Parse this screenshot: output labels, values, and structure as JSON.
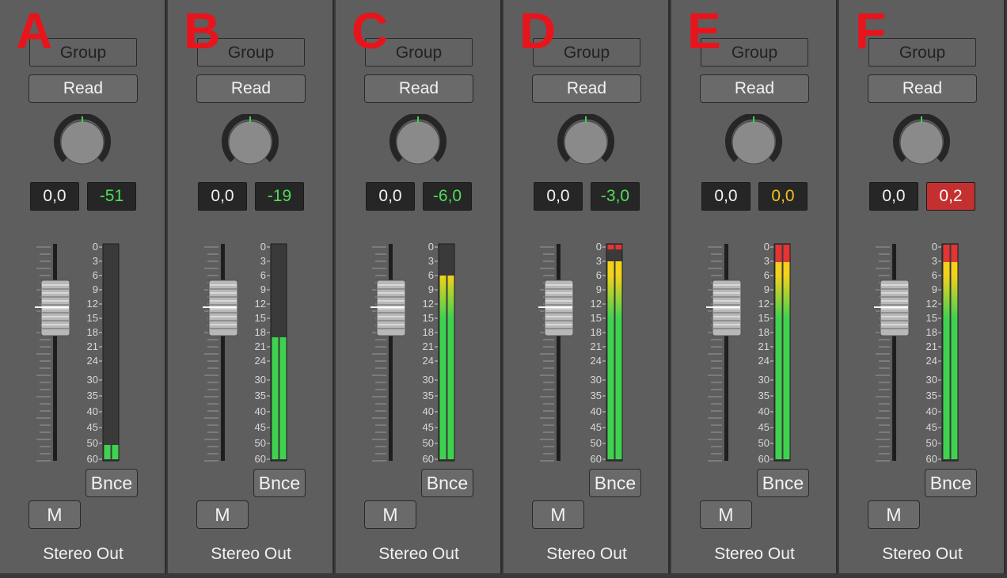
{
  "strips": [
    {
      "letter": "A",
      "group": "Group",
      "automation": "Read",
      "volume": "0,0",
      "peak": "-51",
      "peak_color": "#4fdf5a",
      "peak_bg": "#262626",
      "meter_level_db": 51,
      "clip": false,
      "bounce": "Bnce",
      "mute": "M",
      "name": "Stereo Out"
    },
    {
      "letter": "B",
      "group": "Group",
      "automation": "Read",
      "volume": "0,0",
      "peak": "-19",
      "peak_color": "#4fdf5a",
      "peak_bg": "#262626",
      "meter_level_db": 19,
      "clip": false,
      "bounce": "Bnce",
      "mute": "M",
      "name": "Stereo Out"
    },
    {
      "letter": "C",
      "group": "Group",
      "automation": "Read",
      "volume": "0,0",
      "peak": "-6,0",
      "peak_color": "#4fdf5a",
      "peak_bg": "#262626",
      "meter_level_db": 6,
      "clip": false,
      "bounce": "Bnce",
      "mute": "M",
      "name": "Stereo Out"
    },
    {
      "letter": "D",
      "group": "Group",
      "automation": "Read",
      "volume": "0,0",
      "peak": "-3,0",
      "peak_color": "#4fdf5a",
      "peak_bg": "#262626",
      "meter_level_db": 3,
      "clip": true,
      "bounce": "Bnce",
      "mute": "M",
      "name": "Stereo Out"
    },
    {
      "letter": "E",
      "group": "Group",
      "automation": "Read",
      "volume": "0,0",
      "peak": "0,0",
      "peak_color": "#f2c21c",
      "peak_bg": "#262626",
      "meter_level_db": 0,
      "clip": true,
      "bounce": "Bnce",
      "mute": "M",
      "name": "Stereo Out"
    },
    {
      "letter": "F",
      "group": "Group",
      "automation": "Read",
      "volume": "0,0",
      "peak": "0,2",
      "peak_color": "#ffffff",
      "peak_bg": "#c43030",
      "meter_level_db": 0,
      "clip": true,
      "bounce": "Bnce",
      "mute": "M",
      "name": "Stereo Out"
    }
  ],
  "meter_scale": [
    "0",
    "3",
    "6",
    "9",
    "12",
    "15",
    "18",
    "21",
    "24",
    "30",
    "35",
    "40",
    "45",
    "50",
    "60"
  ],
  "colors": {
    "meter_green": "#3fd24f",
    "meter_yellow": "#f2d21a",
    "meter_red": "#e43434",
    "knob_indicator": "#3fd24f"
  },
  "pan_knob": {
    "value": 0
  }
}
